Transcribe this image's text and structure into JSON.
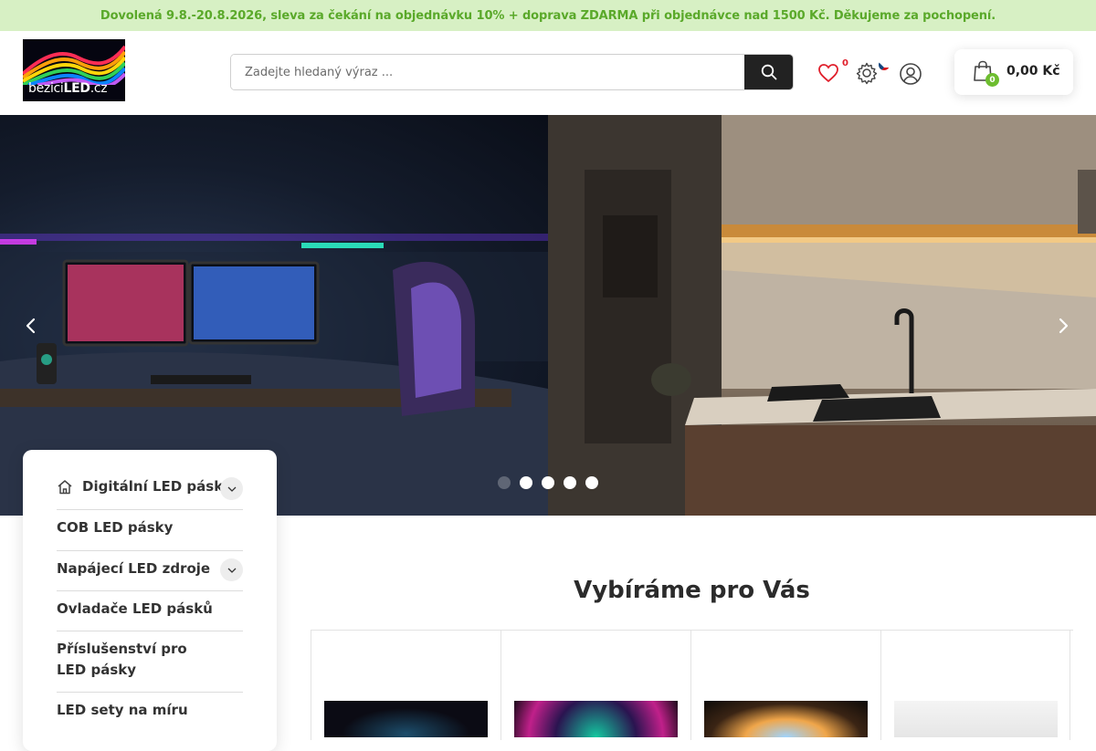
{
  "announcement": "Dovolená 9.8.-20.8.2026, sleva za čekání na objednávku 10% + doprava ZDARMA při objednávce nad 1500 Kč. Děkujeme za pochopení.",
  "logo": {
    "text_plain": "bezici",
    "text_bold": "LED",
    "text_suffix": ".cz"
  },
  "search": {
    "placeholder": "Zadejte hledaný výraz ...",
    "value": ""
  },
  "header": {
    "wishlist_count": "0",
    "cart": {
      "count": "0",
      "total": "0,00 Kč"
    }
  },
  "sidebar": {
    "items": [
      {
        "label": "Digitální LED pásky",
        "expandable": true
      },
      {
        "label": "COB LED pásky",
        "expandable": false
      },
      {
        "label": "Napájecí LED zdroje",
        "expandable": true
      },
      {
        "label": "Ovladače LED pásků",
        "expandable": false
      },
      {
        "label": "Příslušenství pro LED pásky",
        "expandable": false
      },
      {
        "label": "LED sety na míru",
        "expandable": false
      }
    ]
  },
  "main": {
    "section_title": "Vybíráme pro Vás"
  },
  "colors": {
    "accent_green": "#5aa92a",
    "badge_green": "#6dbd2f",
    "wishlist_red": "#e0202c",
    "topbar_bg": "#d7f0c4"
  },
  "slider": {
    "slide_count": 5,
    "active_slide": 1
  }
}
